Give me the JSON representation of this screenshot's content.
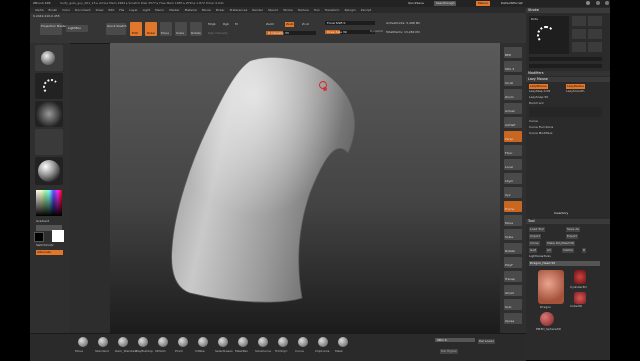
{
  "titlebar": {
    "app": "ZBrush 4R6",
    "info": "Surfy_guts_guy_001_15 ▸ Active Mem 1984 ▸ Scratch Disk 3577 ▸ Free Mem 1887 ▸ ZTime 1.872 Timer 0.041",
    "quicksave": "QuickSave",
    "seethrough": "See-through",
    "seethrough_val": "0",
    "menus": "Menus",
    "defaultzscript": "DefaultZScript"
  },
  "menubar": {
    "items": [
      "Alpha",
      "Brush",
      "Color",
      "Document",
      "Draw",
      "Edit",
      "File",
      "Layer",
      "Light",
      "Macro",
      "Marker",
      "Material",
      "Movie",
      "Picker",
      "Preferences",
      "Render",
      "Stencil",
      "Stroke",
      "Texture",
      "Tool",
      "Transform",
      "Zplugin",
      "Zscript"
    ]
  },
  "coords": "0.2442,210,0.455",
  "shelf": {
    "projection_master": "Projection Master",
    "lightbox": "LightBox",
    "quick_sketch": "Quick Sketch",
    "edit": "Edit",
    "draw": "Draw",
    "move": "Move",
    "scale": "Scale",
    "rotate": "Rotate",
    "mrgb": "Mrgb",
    "rgb": "Rgb",
    "m": "M",
    "rgb_intensity": "Rgb Intensity",
    "zadd": "Zadd",
    "zsub": "Zsub",
    "zcut": "Zcut",
    "z_intensity": "Z Intensity 33",
    "focal_shift": "Focal Shift 0",
    "draw_size": "Draw Size 39",
    "dynamic": "Dynamic",
    "active_points": "ActivePoints: 5,498 Mil",
    "total_points": "TotalPoints: 13,284 Mil"
  },
  "leftshelf": {
    "gradient_label": "Gradient",
    "switch_color_label": "SwitchColor",
    "alternate_label": "Alternate",
    "swatch_main": "#ffffff",
    "swatch_secondary": "#000000",
    "alternate_color": "#e2762b"
  },
  "rightshelf": {
    "buttons": [
      "BPR",
      "SPix 3",
      "Scroll",
      "Zoom",
      "Actual",
      "AAHalf",
      "Persp",
      "Floor",
      "Local",
      "LSym",
      "Xyz",
      "Frame",
      "Move",
      "Scale",
      "Rotate",
      "PolyF",
      "Transp",
      "Ghost",
      "Solo",
      "Xpose"
    ]
  },
  "bottomshelf": {
    "brushes": [
      "Move",
      "Standard",
      "Dam_Standard",
      "ClayBuildup",
      "hPolish",
      "Pinch",
      "Inflate",
      "SelectLasso",
      "MaskPen",
      "SliceCurve",
      "TrimDyn",
      "Curve",
      "ClipCurve",
      "Mask"
    ],
    "sdiv": "SDiv 4",
    "del_lower": "Del Lower",
    "del_higher": "Del Higher"
  },
  "tray": {
    "stroke_title": "Stroke",
    "dots_label": "Dots",
    "modifiers": "Modifiers",
    "lazymouse_title": "Lazy Mouse",
    "lazymouse_btn": "LazyMouse",
    "lazyradius": "LazyRadius",
    "lazystep": "LazyStep 0.05",
    "lazysmooth": "LazySmooth",
    "lazysnap": "LazySnap 50",
    "backtrack": "Backtrack",
    "curve": "Curve",
    "curve_functions": "Curve Functions",
    "curve_modifiers": "Curve Modifiers",
    "inventory": "Inventory",
    "tool_title": "Tool",
    "load_tool": "Load Tool",
    "save_as": "Save As",
    "import": "Import",
    "export": "Export",
    "clone": "Clone",
    "make_polymesh": "Make PolyMesh3D",
    "goz": "GoZ",
    "all": "All",
    "visible": "Visible",
    "r": "R",
    "lightbox_tools": "Lightbox▸Tools",
    "current_tool": "Dragon_Head 50",
    "tool_names": [
      "Dragon",
      "Cylinder3D",
      "Cube3D",
      "PM3D_Sphere3D"
    ]
  }
}
